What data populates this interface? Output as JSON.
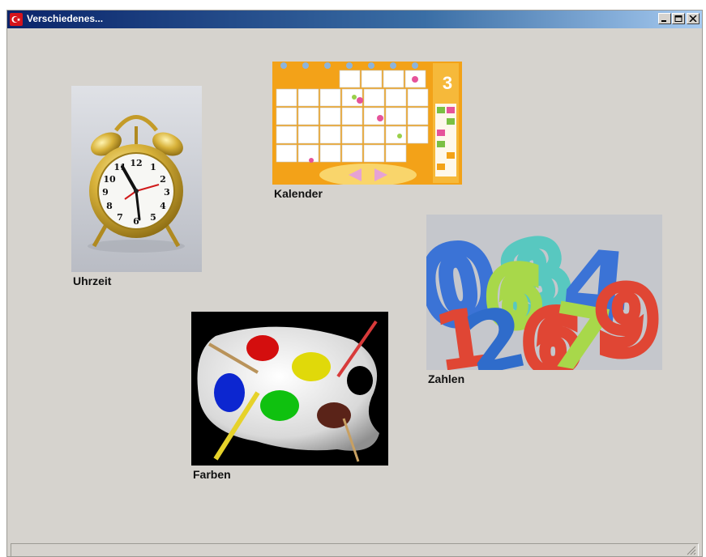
{
  "window": {
    "title": "Verschiedenes...",
    "controls": [
      "minimize",
      "maximize",
      "close"
    ]
  },
  "tiles": {
    "clock": {
      "label": "Uhrzeit"
    },
    "calendar": {
      "label": "Kalender",
      "month_number": "3"
    },
    "numbers": {
      "label": "Zahlen"
    },
    "colors": {
      "label": "Farben"
    }
  }
}
